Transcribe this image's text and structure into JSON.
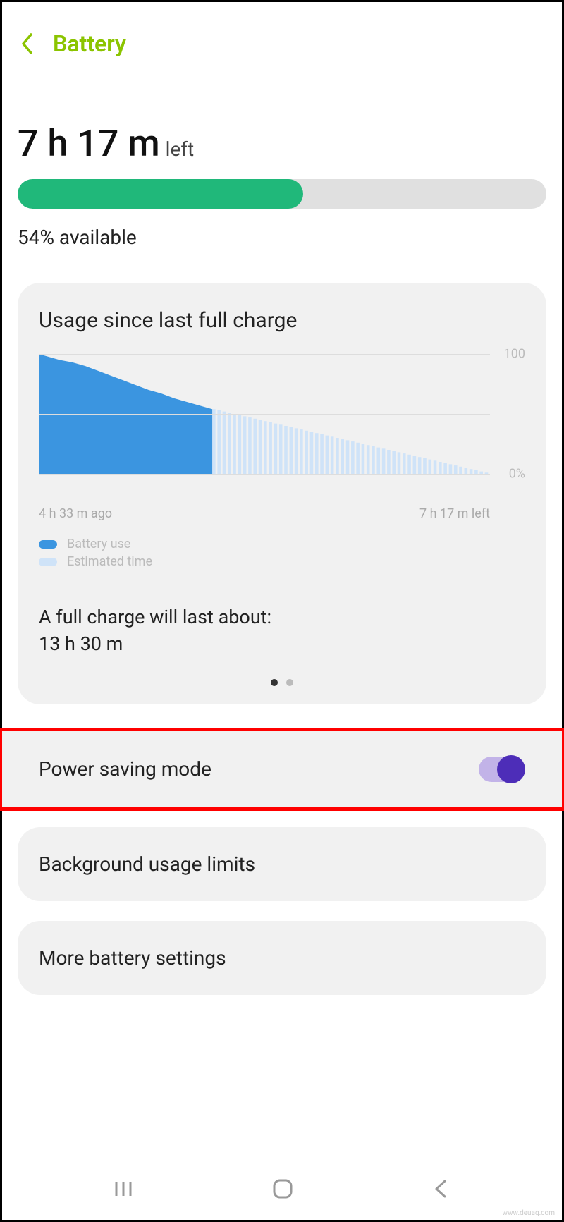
{
  "header": {
    "title": "Battery"
  },
  "battery": {
    "time_left": "7 h 17 m",
    "time_left_suffix": "left",
    "percent": 54,
    "percent_label": "54% available"
  },
  "usage_card": {
    "title": "Usage since last full charge",
    "y_top": "100",
    "y_bottom": "0%",
    "x_start": "4 h 33 m ago",
    "x_end": "7 h 17 m left",
    "legend": {
      "use_label": "Battery use",
      "use_color": "#3b95e0",
      "est_label": "Estimated time",
      "est_color": "#cfe3f8"
    },
    "full_charge_line1": "A full charge will last about:",
    "full_charge_line2": "13 h 30 m"
  },
  "chart_data": {
    "type": "area",
    "x_range_minutes": [
      -273,
      437
    ],
    "now_minute": 0,
    "ylim": [
      0,
      100
    ],
    "series": [
      {
        "name": "Battery use",
        "color": "#3b95e0",
        "points": [
          {
            "x": -273,
            "y": 100
          },
          {
            "x": -260,
            "y": 98
          },
          {
            "x": -240,
            "y": 95
          },
          {
            "x": -220,
            "y": 93
          },
          {
            "x": -200,
            "y": 90
          },
          {
            "x": -180,
            "y": 86
          },
          {
            "x": -160,
            "y": 82
          },
          {
            "x": -140,
            "y": 78
          },
          {
            "x": -120,
            "y": 74
          },
          {
            "x": -100,
            "y": 70
          },
          {
            "x": -80,
            "y": 67
          },
          {
            "x": -60,
            "y": 63
          },
          {
            "x": -40,
            "y": 60
          },
          {
            "x": -20,
            "y": 57
          },
          {
            "x": 0,
            "y": 54
          }
        ]
      },
      {
        "name": "Estimated time",
        "color": "#cfe3f8",
        "points": [
          {
            "x": 0,
            "y": 54
          },
          {
            "x": 437,
            "y": 0
          }
        ]
      }
    ]
  },
  "settings": {
    "power_saving": "Power saving mode",
    "power_saving_on": true,
    "bg_limits": "Background usage limits",
    "more": "More battery settings"
  },
  "watermark": "www.deuaq.com"
}
